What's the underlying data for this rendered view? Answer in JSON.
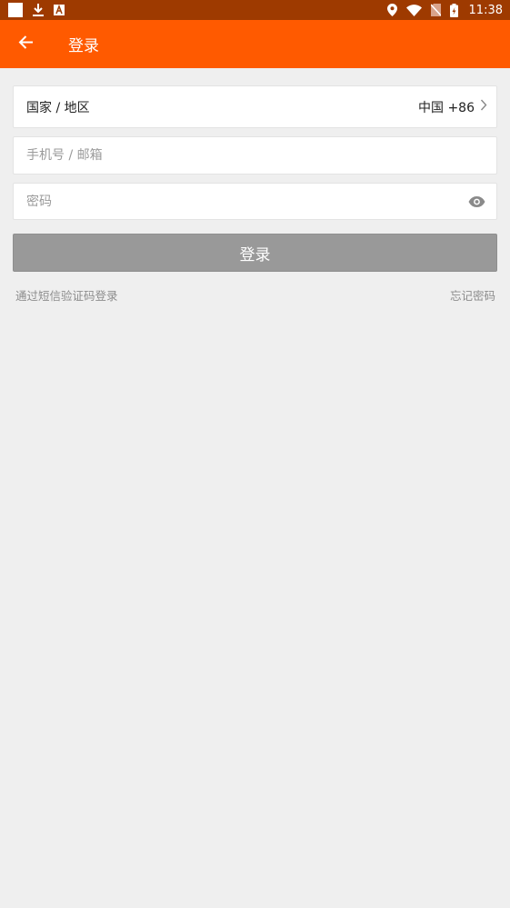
{
  "status_bar": {
    "time": "11:38",
    "icons": [
      "notification-square-icon",
      "download-icon",
      "font-a-icon",
      "location-icon",
      "wifi-icon",
      "no-sim-icon",
      "battery-charging-icon"
    ]
  },
  "app_bar": {
    "title": "登录",
    "back_icon": "arrow-left-icon"
  },
  "form": {
    "country_label": "国家 / 地区",
    "country_value": "中国 +86",
    "phone_placeholder": "手机号 / 邮箱",
    "phone_value": "",
    "password_placeholder": "密码",
    "password_value": ""
  },
  "login_button_label": "登录",
  "links": {
    "sms_login": "通过短信验证码登录",
    "forgot_password": "忘记密码"
  },
  "colors": {
    "status_bar": "#9e3a00",
    "app_bar": "#ff5a00",
    "background": "#efefef",
    "button_disabled": "#999999"
  }
}
